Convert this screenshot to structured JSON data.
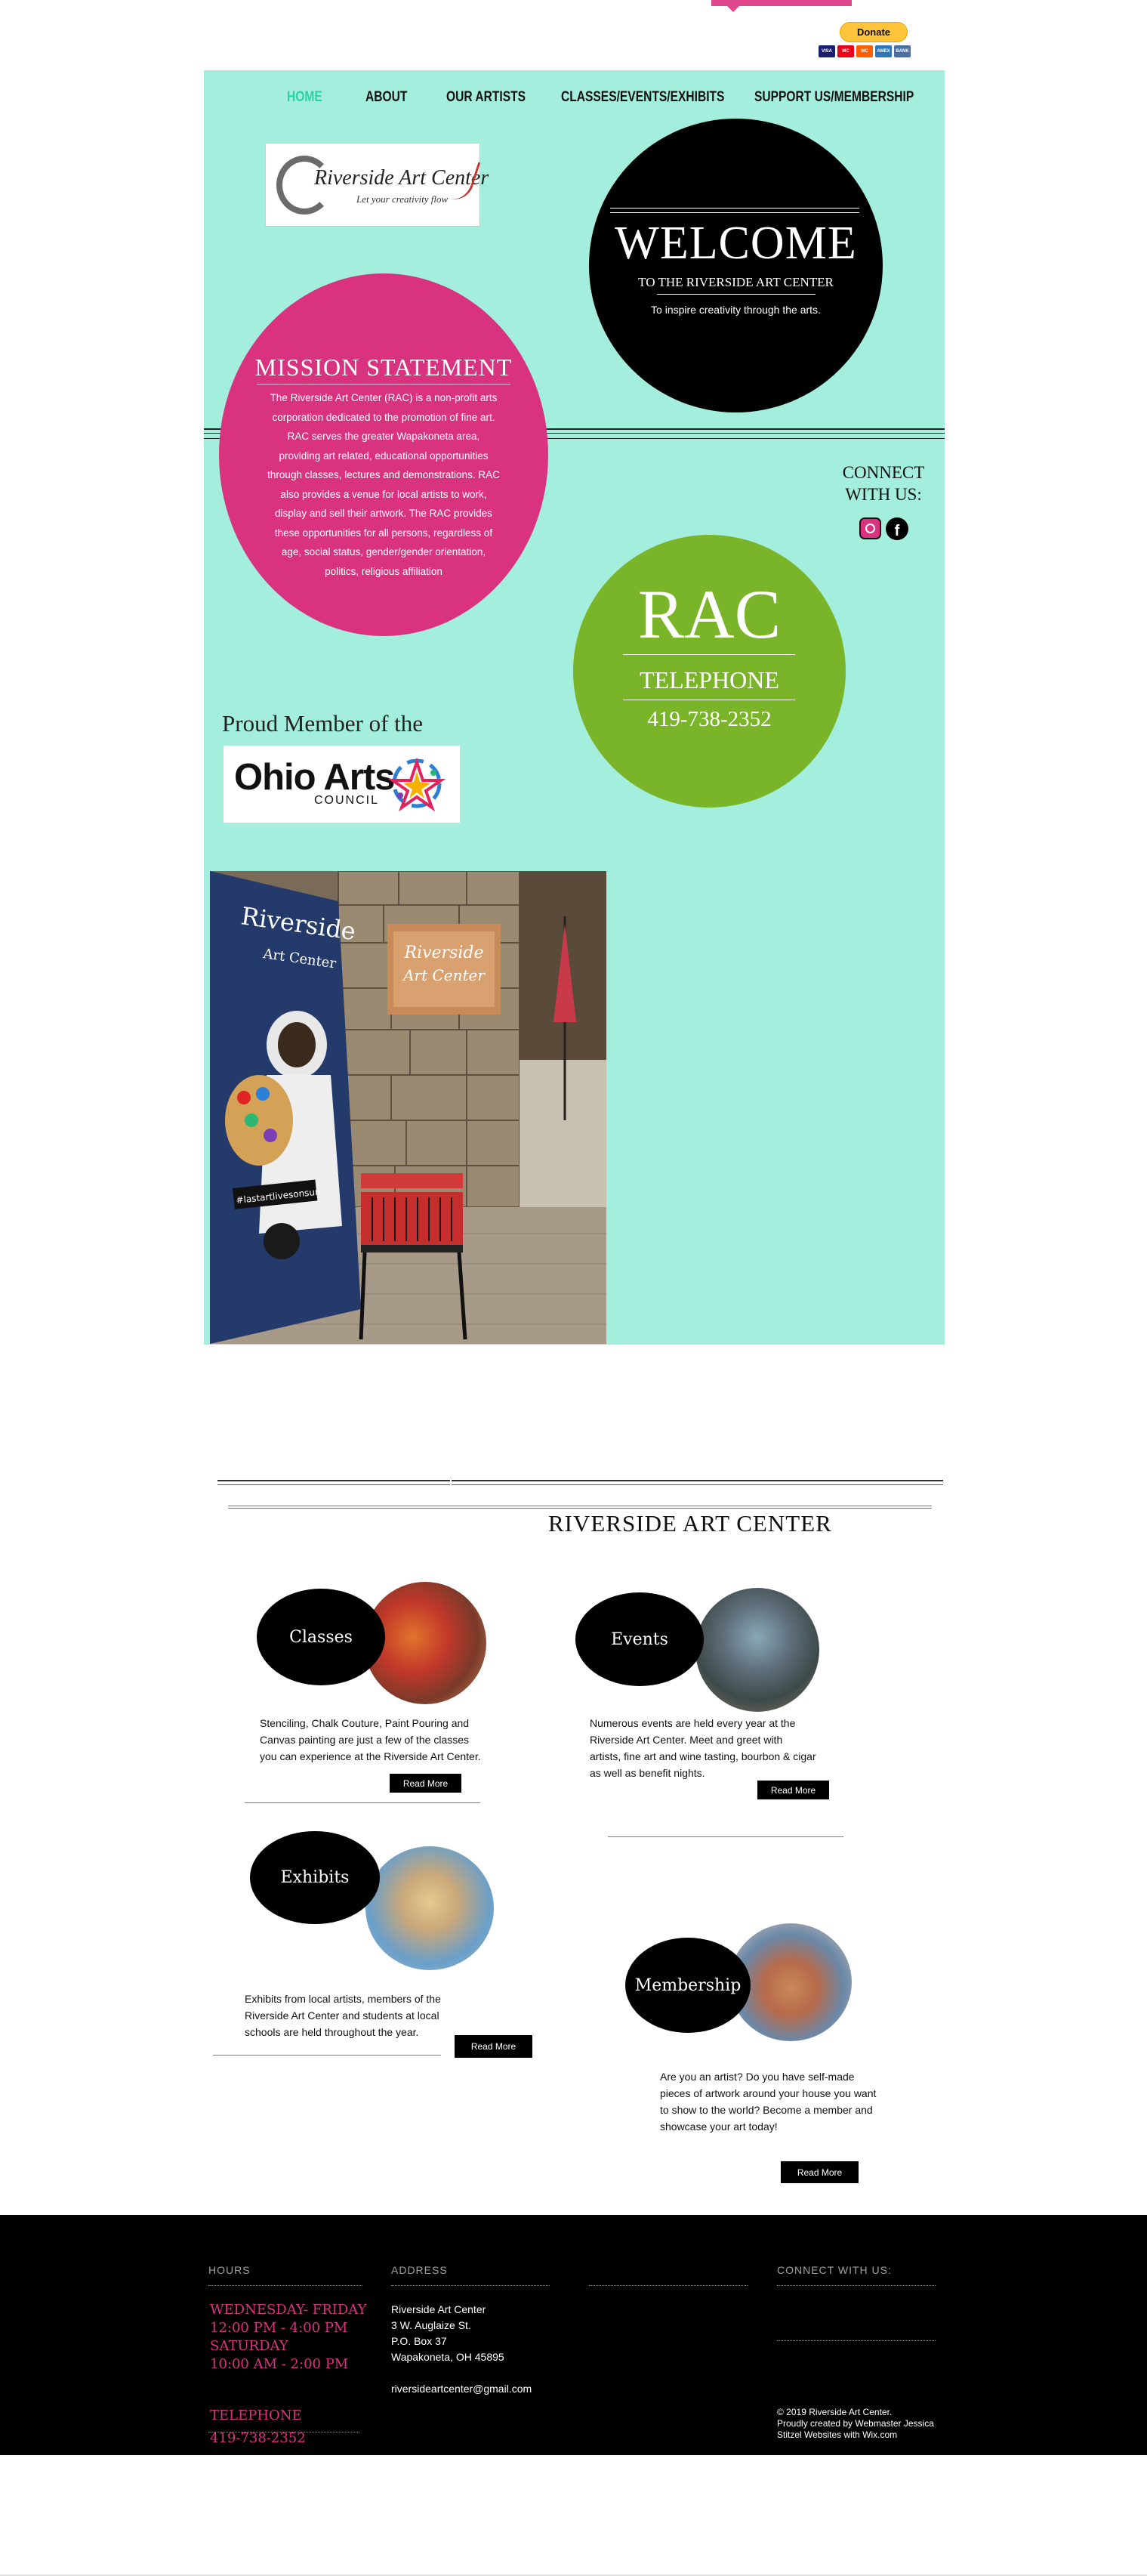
{
  "topbar": {
    "donate_label": "Donate",
    "payment_cards": [
      "VISA",
      "MC",
      "MC",
      "AMEX",
      "BANK"
    ]
  },
  "nav": {
    "items": [
      "HOME",
      "ABOUT",
      "OUR ARTISTS",
      "CLASSES/EVENTS/EXHIBITS",
      "SUPPORT US/MEMBERSHIP"
    ],
    "active": "HOME"
  },
  "logo": {
    "title": "Riverside Art Center",
    "tagline": "Let your creativity flow"
  },
  "welcome": {
    "title": "WELCOME",
    "subtitle": "TO THE RIVERSIDE ART CENTER",
    "text": "To inspire creativity through the arts."
  },
  "mission": {
    "title": "MISSION STATEMENT",
    "text": "The Riverside Art Center (RAC) is a non-profit arts corporation dedicated to the promotion of fine art. RAC serves the greater Wapakoneta area, providing art related, educational opportunities through classes, lectures and demonstrations. RAC also provides a venue for local artists to work, display and sell their artwork. The RAC provides these opportunities for all persons, regardless of age, social status, gender/gender orientation, politics, religious affiliation"
  },
  "connect": {
    "label": "CONNECT WITH US:"
  },
  "rac": {
    "title": "RAC",
    "telephone_label": "TELEPHONE",
    "phone": "419-738-2352"
  },
  "proud": {
    "text": "Proud Member of the",
    "oac_name": "Ohio Arts",
    "oac_sub": "COUNCIL"
  },
  "photo": {
    "board_title": "Riverside",
    "board_sub": "Art Center",
    "banner_title": "Riverside",
    "banner_sub": "Art Center",
    "hashtag": "#lastartlivesonsun"
  },
  "section2": {
    "title": "RIVERSIDE ART CENTER",
    "cards": [
      {
        "label": "Classes",
        "text": "Stenciling, Chalk Couture, Paint Pouring and Canvas painting are just a few of the classes you can experience at the Riverside Art Center.",
        "button": "Read More"
      },
      {
        "label": "Events",
        "text": "Numerous events are held every year at the Riverside Art Center. Meet and greet with artists, fine art and wine tasting, bourbon & cigar  as well as benefit nights.",
        "button": "Read More"
      },
      {
        "label": "Exhibits",
        "text": "Exhibits from local artists, members of the Riverside Art Center and students at local schools are held throughout the year.",
        "button": "Read More"
      },
      {
        "label": "Membership",
        "text": "Are you an artist? Do you have self-made pieces of artwork around your house you want to show to the world? Become a member and showcase your art today!",
        "button": "Read More"
      }
    ]
  },
  "footer": {
    "hours_heading": "HOURS",
    "hours_line1": "WEDNESDAY- FRIDAY",
    "hours_line2": "12:00 PM - 4:00 PM",
    "hours_line3": "SATURDAY",
    "hours_line4": "10:00 AM - 2:00 PM",
    "telephone_heading": "TELEPHONE",
    "telephone": "419-738-2352",
    "address_heading": "ADDRESS",
    "address_line1": "Riverside Art Center",
    "address_line2": "3 W. Auglaize St.",
    "address_line3": "P.O. Box 37",
    "address_line4": "Wapakoneta, OH 45895",
    "email": "riversideartcenter@gmail.com",
    "connect_heading": "CONNECT WITH US:",
    "copyright1": "© 2019 Riverside  Art Center.",
    "copyright2": "Proudly created by Webmaster Jessica",
    "copyright3": "Stitzel Websites with Wix.com"
  },
  "colors": {
    "teal": "#a3eedd",
    "pink": "#d9337f",
    "green": "#7ab529",
    "nav_active": "#2ed3a2",
    "black": "#000000"
  }
}
